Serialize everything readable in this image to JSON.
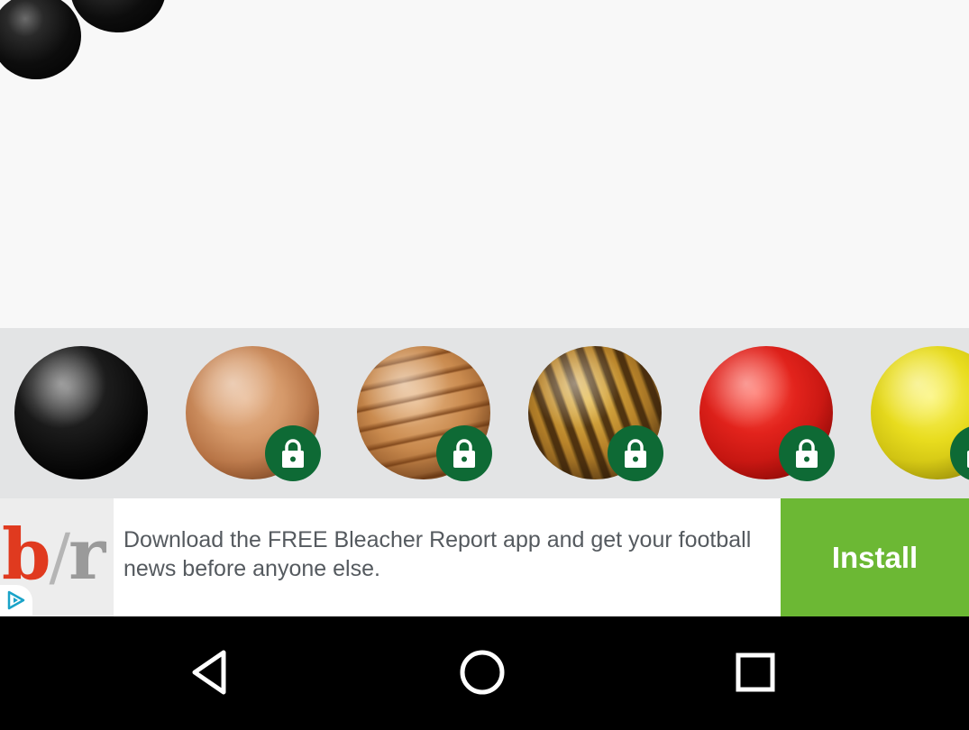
{
  "game": {
    "balls": [
      {
        "name": "black",
        "locked": false
      },
      {
        "name": "light-wood",
        "locked": true
      },
      {
        "name": "striped-wood",
        "locked": true
      },
      {
        "name": "tiger-eye",
        "locked": true
      },
      {
        "name": "red",
        "locked": true
      },
      {
        "name": "yellow",
        "locked": true
      }
    ]
  },
  "ad": {
    "text": "Download the FREE Bleacher Report app and get your football news before anyone else.",
    "cta_label": "Install",
    "logo_text": "b/r",
    "cta_color": "#6cb834"
  },
  "navbar": {
    "back_icon": "back-triangle-icon",
    "home_icon": "home-circle-icon",
    "recent_icon": "recent-apps-square-icon"
  },
  "colors": {
    "lock_badge": "#0e6a35",
    "picker_bg": "#e3e4e5"
  }
}
